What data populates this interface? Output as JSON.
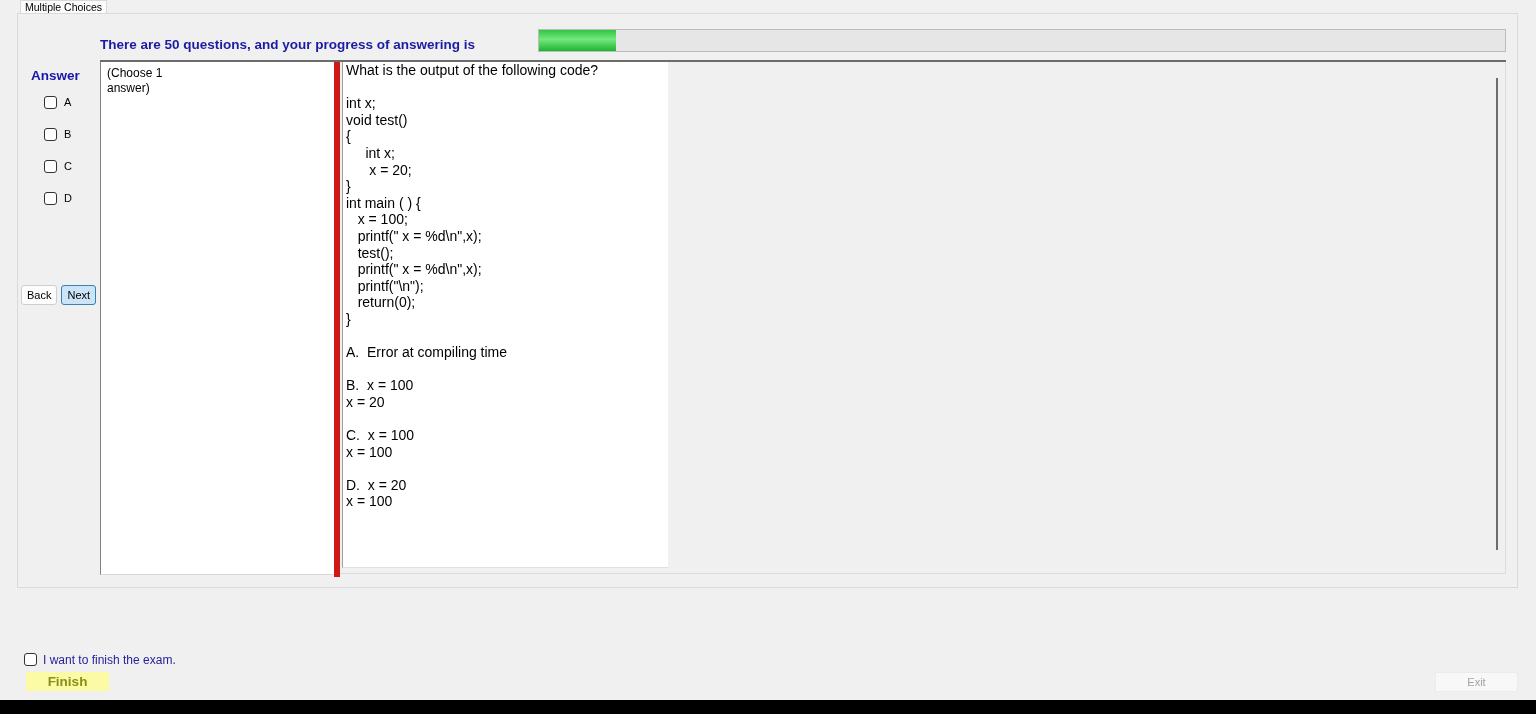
{
  "tabs": [
    {
      "label": "Multiple Choices",
      "selected": true
    }
  ],
  "progress": {
    "text": "There are 50 questions, and your progress of answering is",
    "level": 0.08
  },
  "answer_panel": {
    "title": "Answer",
    "options": [
      {
        "label": "A",
        "checked": false
      },
      {
        "label": "B",
        "checked": false
      },
      {
        "label": "C",
        "checked": false
      },
      {
        "label": "D",
        "checked": false
      }
    ]
  },
  "navigation": [
    {
      "label": "Back",
      "focused": false
    },
    {
      "label": "Next",
      "focused": true
    }
  ],
  "hint": "(Choose 1\nanswer)",
  "question": {
    "prompt": "What is the output of the following code?",
    "code": "int x;\nvoid test()\n{\n     int x;\n      x = 20;\n}\nint main ( ) {\n   x = 100;\n   printf(\" x = %d\\n\",x);\n   test();\n   printf(\" x = %d\\n\",x);\n   printf(\"\\n\");\n   return(0);\n}",
    "options": [
      "A.  Error at compiling time",
      "B.  x = 100\nx = 20",
      "C.  x = 100\nx = 100",
      "D.  x = 20\nx = 100"
    ]
  },
  "finish_confirm": {
    "label": "I want to finish the exam.",
    "checked": false
  },
  "finish_button": {
    "label": "Finish"
  },
  "exit_button": {
    "label": "Exit",
    "disabled": true
  }
}
